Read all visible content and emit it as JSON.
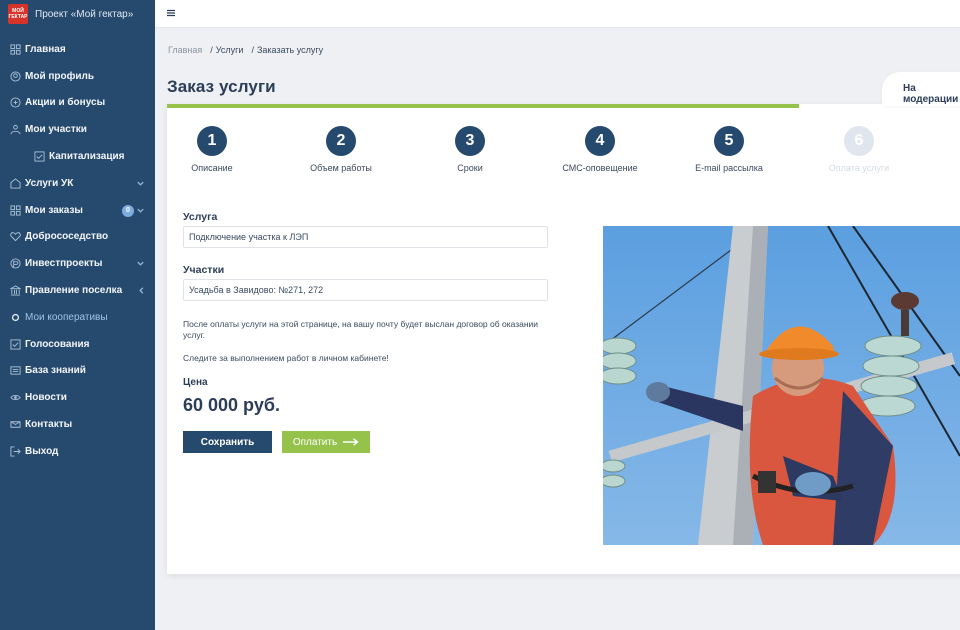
{
  "brand": {
    "logo_text_top": "МОЙ",
    "logo_text_bottom": "ГЕКТАР",
    "title": "Проект «Мой гектар»"
  },
  "sidebar": {
    "items": [
      {
        "label": "Главная",
        "icon": "grid-icon"
      },
      {
        "label": "Мой профиль",
        "icon": "profile-icon"
      },
      {
        "label": "Акции и бонусы",
        "icon": "gift-icon"
      },
      {
        "label": "Мои участки",
        "icon": "plots-icon"
      },
      {
        "label": "Капитализация",
        "icon": "check-square-icon"
      },
      {
        "label": "Услуги УК",
        "icon": "services-icon"
      },
      {
        "label": "Мои заказы",
        "icon": "orders-icon",
        "badge": "0"
      },
      {
        "label": "Добрососедство",
        "icon": "heart-icon"
      },
      {
        "label": "Инвестпроекты",
        "icon": "invest-icon"
      },
      {
        "label": "Правление поселка",
        "icon": "board-icon"
      },
      {
        "label": "Мои кооперативы",
        "icon": "circle-icon"
      },
      {
        "label": "Голосования",
        "icon": "vote-icon"
      },
      {
        "label": "База знаний",
        "icon": "knowledge-icon"
      },
      {
        "label": "Новости",
        "icon": "news-icon"
      },
      {
        "label": "Контакты",
        "icon": "contacts-icon"
      },
      {
        "label": "Выход",
        "icon": "exit-icon"
      }
    ]
  },
  "breadcrumb": {
    "home": "Главная",
    "services": "Услуги",
    "current": "Заказать услугу"
  },
  "page": {
    "title": "Заказ услуги",
    "status_tab": "На модерации"
  },
  "progress": 0.79,
  "steps": [
    {
      "num": "1",
      "label": "Описание"
    },
    {
      "num": "2",
      "label": "Объем работы"
    },
    {
      "num": "3",
      "label": "Сроки"
    },
    {
      "num": "4",
      "label": "СМС-оповещение"
    },
    {
      "num": "5",
      "label": "E-mail рассылка"
    },
    {
      "num": "6",
      "label": "Оплата услуги"
    }
  ],
  "form": {
    "service_label": "Услуга",
    "service_value": "Подключение участка к ЛЭП",
    "plots_label": "Участки",
    "plots_value": "Усадьба в Завидово: №271, 272",
    "info_1": "После оплаты услуги на этой странице, на вашу почту будет выслан договор об оказании услуг.",
    "info_2": "Следите за выполнением работ в личном кабинете!",
    "price_label": "Цена",
    "price_value": "60 000 руб."
  },
  "buttons": {
    "save": "Сохранить",
    "pay": "Оплатить"
  },
  "colors": {
    "sidebar": "#264a6e",
    "accent": "#94c24a",
    "step": "#264a6e"
  }
}
